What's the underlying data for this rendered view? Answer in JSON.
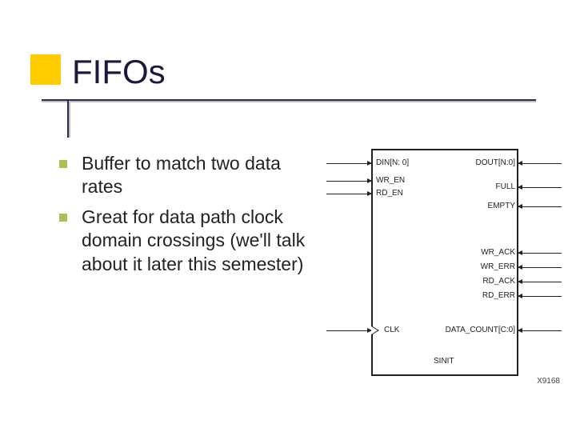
{
  "slide": {
    "title": "FIFOs",
    "bullets": [
      "Buffer to match two data rates",
      "Great for data path clock domain crossings (we'll talk about it later this semester)"
    ]
  },
  "diagram": {
    "left_pins": [
      "DIN[N: 0]",
      "WR_EN",
      "RD_EN"
    ],
    "right_pins_top": [
      "DOUT[N:0]",
      "FULL",
      "EMPTY"
    ],
    "right_pins_mid": [
      "WR_ACK",
      "WR_ERR",
      "RD_ACK",
      "RD_ERR"
    ],
    "clk_label": "CLK",
    "right_pins_bottom": [
      "DATA_COUNT[C:0]"
    ],
    "bottom_label": "SINIT",
    "corner_id": "X9168"
  }
}
